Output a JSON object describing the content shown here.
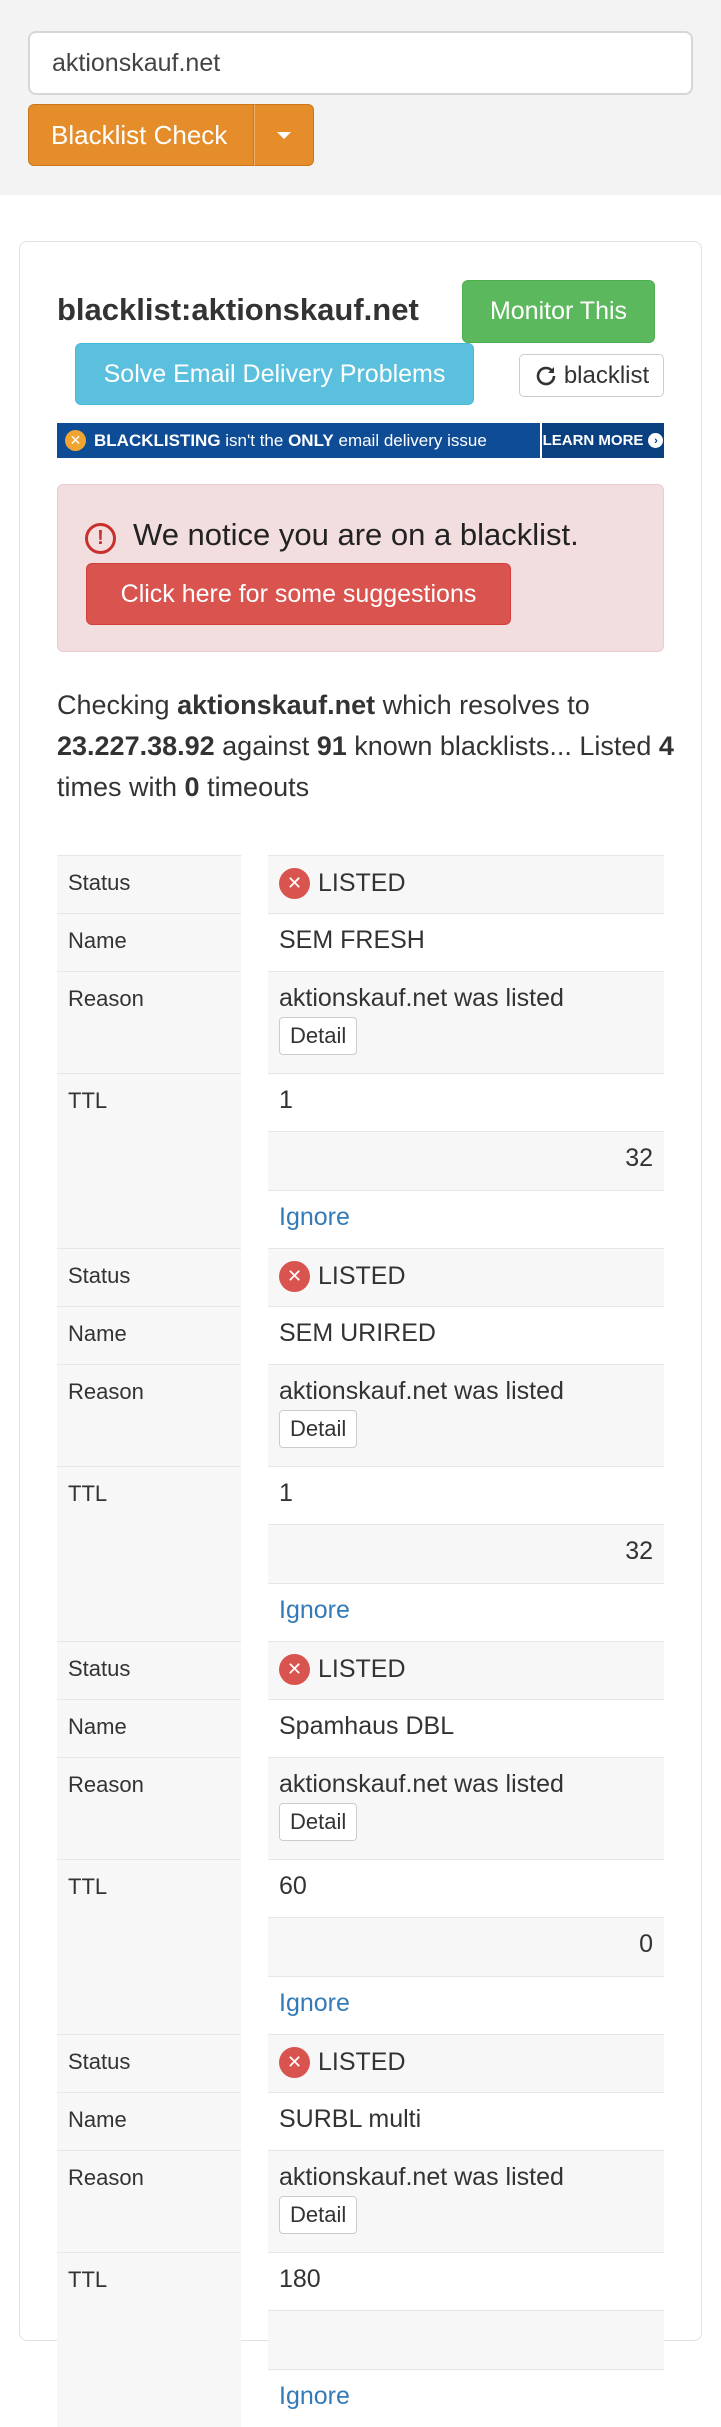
{
  "search": {
    "value": "aktionskauf.net"
  },
  "buttons": {
    "check": "Blacklist Check",
    "monitor": "Monitor This",
    "solve": "Solve Email Delivery Problems",
    "refresh": "blacklist"
  },
  "title": "blacklist:aktionskauf.net",
  "banner": {
    "part1": "BLACKLISTING",
    "part2": "isn't the",
    "part3": "ONLY",
    "part4": "email delivery issue",
    "learn": "LEARN MORE"
  },
  "alert": {
    "text": "We notice you are on a blacklist.",
    "button": "Click here for some suggestions"
  },
  "summary": {
    "t1": "Checking ",
    "domain": "aktionskauf.net",
    "t2": " which resolves to ",
    "ip": "23.227.38.92",
    "t3": " against ",
    "count": "91",
    "t4": " known blacklists... Listed ",
    "listed": "4",
    "t5": " times with ",
    "timeouts": "0",
    "t6": " timeouts"
  },
  "labels": {
    "status": "Status",
    "name": "Name",
    "reason": "Reason",
    "ttl": "TTL"
  },
  "detail_label": "Detail",
  "ignore_label": "Ignore",
  "results": [
    {
      "status": "LISTED",
      "name": "SEM FRESH",
      "reason": "aktionskauf.net was listed",
      "ttl": "1",
      "extra": "32"
    },
    {
      "status": "LISTED",
      "name": "SEM URIRED",
      "reason": "aktionskauf.net was listed",
      "ttl": "1",
      "extra": "32"
    },
    {
      "status": "LISTED",
      "name": "Spamhaus DBL",
      "reason": "aktionskauf.net was listed",
      "ttl": "60",
      "extra": "0"
    },
    {
      "status": "LISTED",
      "name": "SURBL multi",
      "reason": "aktionskauf.net was listed",
      "ttl": "180",
      "extra": ""
    }
  ],
  "colors": {
    "check": "#e58d2a",
    "monitor": "#5cb85c",
    "solve": "#5bc0de",
    "danger": "#d9534f",
    "link": "#337ab7"
  }
}
